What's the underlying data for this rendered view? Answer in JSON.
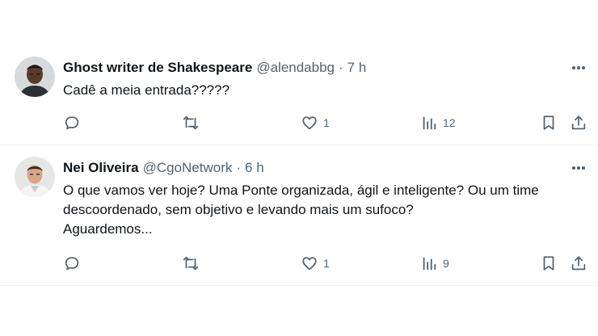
{
  "replies": [
    {
      "author_name": "Ghost writer de Shakespeare",
      "handle": "@alendabbg",
      "separator": "·",
      "time": "7 h",
      "text_lines": [
        "Cadê a meia entrada?????"
      ],
      "stats": {
        "replies": "",
        "reposts": "",
        "likes": "1",
        "views": "12"
      }
    },
    {
      "author_name": "Nei Oliveira",
      "handle": "@CgoNetwork",
      "separator": "·",
      "time": "6 h",
      "text_lines": [
        "O que vamos ver hoje? Uma Ponte organizada, ágil e inteligente? Ou um time",
        "descoordenado, sem objetivo e levando mais um sufoco?",
        "Aguardemos..."
      ],
      "stats": {
        "replies": "",
        "reposts": "",
        "likes": "1",
        "views": "9"
      }
    }
  ],
  "icons": {
    "reply": "speech-bubble-icon",
    "repost": "repost-arrows-icon",
    "like": "heart-icon",
    "views": "bar-chart-icon",
    "bookmark": "bookmark-icon",
    "share": "share-upload-icon",
    "more": "more-horizontal-icon"
  },
  "colors": {
    "text": "#0f1419",
    "secondary": "#536471",
    "divider": "#eff3f4",
    "background": "#ffffff"
  }
}
